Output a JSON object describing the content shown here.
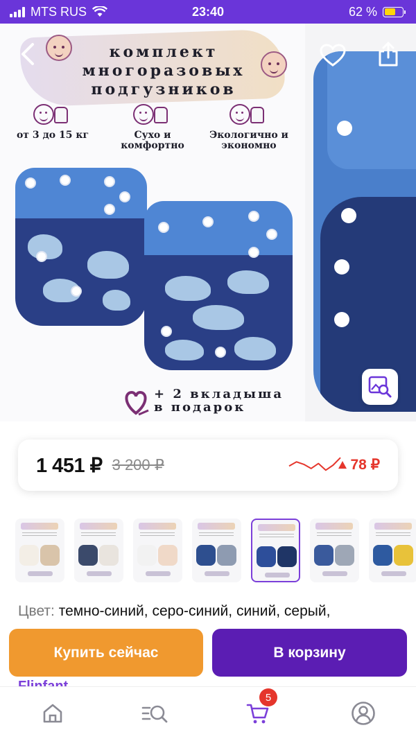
{
  "status_bar": {
    "carrier": "MTS RUS",
    "time": "23:40",
    "battery_percent": "62 %",
    "battery_level": 0.62
  },
  "hero": {
    "title_lines": [
      "комплект",
      "многоразовых",
      "подгузников"
    ],
    "features": [
      {
        "text": "от 3 до 15 кг"
      },
      {
        "text": "Сухо и комфортно"
      },
      {
        "text": "Экологично и экономно"
      }
    ],
    "gift_lines": [
      "+ 2 вкладыша",
      "в подарок"
    ],
    "icons": {
      "back": "back-arrow-icon",
      "favorite": "heart-icon",
      "share": "share-icon",
      "zoom": "image-search-icon"
    }
  },
  "price": {
    "current": "1 451 ₽",
    "old": "3 200 ₽",
    "change": "78 ₽",
    "change_color": "#e5362c",
    "trend_values": [
      0.45,
      0.7,
      0.55,
      0.3,
      0.6,
      0.2,
      0.5,
      0.95
    ]
  },
  "thumbnails": [
    {
      "colors": [
        "#f3eee6",
        "#d9c4aa"
      ]
    },
    {
      "colors": [
        "#3b4a6b",
        "#e9e4de"
      ]
    },
    {
      "colors": [
        "#f2f2f2",
        "#f0d9c8"
      ]
    },
    {
      "colors": [
        "#2e4f8f",
        "#8e9bb1"
      ]
    },
    {
      "colors": [
        "#2d4e9a",
        "#1f3566"
      ],
      "active": true
    },
    {
      "colors": [
        "#3a5a9c",
        "#9ea7b6"
      ]
    },
    {
      "colors": [
        "#2e5aa0",
        "#e8c23a"
      ]
    }
  ],
  "color_field": {
    "label": "Цвет:",
    "value": "темно-синий, серо-синий, синий, серый,"
  },
  "buttons": {
    "buy_now": "Купить сейчас",
    "add_to_cart": "В корзину"
  },
  "seller_peek": "Flinfant",
  "tabbar": {
    "items": [
      "home-icon",
      "catalog-search-icon",
      "cart-icon",
      "profile-icon"
    ],
    "cart_badge": "5"
  },
  "colors": {
    "accent_purple": "#5b1db3",
    "status_bar": "#6a35d9",
    "buy_orange": "#f0992f"
  }
}
